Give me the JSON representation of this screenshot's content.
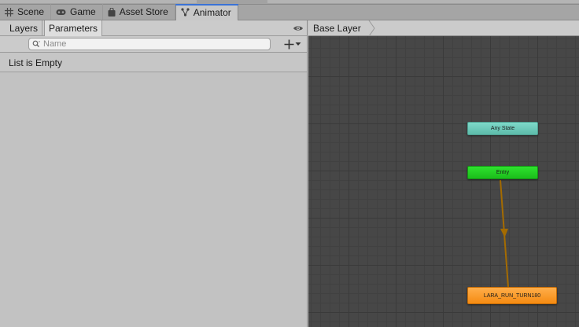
{
  "tabs": [
    {
      "label": "Scene",
      "icon": "grid-icon",
      "active": false
    },
    {
      "label": "Game",
      "icon": "gamepad-icon",
      "active": false
    },
    {
      "label": "Asset Store",
      "icon": "shopping-bag-icon",
      "active": false
    },
    {
      "label": "Animator",
      "icon": "animator-icon",
      "active": true
    }
  ],
  "left_panel": {
    "subtabs": {
      "layers": "Layers",
      "parameters": "Parameters"
    },
    "search": {
      "placeholder": "Name",
      "value": ""
    },
    "list_status": "List is Empty",
    "icons": [
      "eye-icon",
      "search-icon",
      "plus-icon",
      "dropdown-arrow-icon"
    ]
  },
  "graph": {
    "breadcrumb": "Base Layer",
    "nodes": {
      "any_state": "Any State",
      "entry": "Entry",
      "lara_run_turn": "LARA_RUN_TURN180"
    },
    "colors": {
      "background": "#474747",
      "any_state": "#6ccbba",
      "entry": "#23d223",
      "default_state": "#f79a2a",
      "transition": "#a46b00"
    }
  }
}
